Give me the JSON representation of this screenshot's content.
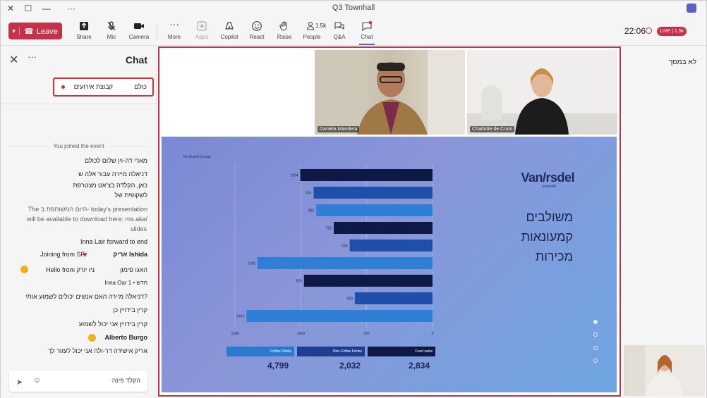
{
  "window": {
    "title": "Q3 Townhall",
    "buttons": {
      "close": "✕",
      "maximize": "☐",
      "minimize": "—",
      "more": "···"
    }
  },
  "toolbar": {
    "leave_label": "Leave",
    "leave_chevron": "▾",
    "share_label": "Share",
    "mic_label": "Mic",
    "camera_label": "Camera",
    "more_label": "More",
    "apps_label": "Apps",
    "copilot_label": "Copilot",
    "react_label": "React",
    "raise_label": "Raise",
    "people_label": "People",
    "people_count": "1.5k",
    "qa_label": "Q&A",
    "chat_label": "Chat",
    "timer": "22:06",
    "live_badge": "LIVE | 1.5k"
  },
  "chat": {
    "title": "Chat",
    "tab_everyone": "כולם",
    "tab_group": "קבוצת אירועים",
    "joined": "You joined the event",
    "messages": [
      {
        "text": "מארי דה-וין   שלום לכולם"
      },
      {
        "text": "דניאלה מיירה   עבור אלה ש"
      },
      {
        "text": "כאן, הקלדה בצ'אט מצטרפת"
      },
      {
        "text": "לשקופית של"
      },
      {
        "text": "The היום המשותפת ב- today's presentation"
      },
      {
        "text": "will be available to download here: ms.aka/"
      },
      {
        "text": "slides"
      },
      {
        "text": "Inna Lair forward to end"
      },
      {
        "author": "אריק Ishida",
        "text": "Joining from SF"
      },
      {
        "author": "האגו סימון",
        "text": "Hello  from ניו יורק"
      },
      {
        "text": "Inna Oar  חדש • 1"
      },
      {
        "text": "דניאלה מיירה   האם אנשים יכולים לשמוע אותי?"
      },
      {
        "text": "קרין בידויין   כן"
      },
      {
        "text": "קרין בידויין   אני יכול לשמוע"
      },
      {
        "author": "Alberto Burgo"
      },
      {
        "text": "אריק אישידה  דר-ולה אני יכול לעזור לך"
      }
    ],
    "compose_placeholder": "הקלד פינה"
  },
  "stage": {
    "participants": [
      {
        "name": "Daniela Mandera"
      },
      {
        "name": "Charlotte de Crum"
      }
    ],
    "slide": {
      "brand": "Van/rsdel",
      "brand_sub": "presents",
      "small_tag": "FA Shared Design",
      "heading_lines": [
        "משולבים",
        "קמעונאות",
        "מכירות"
      ],
      "legend": [
        "Food sales",
        "Non-Coffee Drinks",
        "Coffee Drinks"
      ],
      "totals": [
        "2,834",
        "2,032",
        "4,799"
      ]
    }
  },
  "chart_data": {
    "type": "bar",
    "orientation": "horizontal",
    "values": [
      1004,
      903,
      883,
      750,
      629,
      1330,
      976,
      590,
      1412
    ],
    "xticks": [
      "0",
      "500",
      "1000",
      "1500"
    ],
    "xlim": [
      0,
      1500
    ]
  },
  "right_panel": {
    "label": "לא במסך"
  },
  "colors": {
    "leave": "#c4314b",
    "accent": "#5b5fc7",
    "highlight_border": "#d13438",
    "bar_dark": "#0e1a45",
    "bar_mid": "#1f4fa8",
    "bar_light": "#2f7fd6"
  }
}
